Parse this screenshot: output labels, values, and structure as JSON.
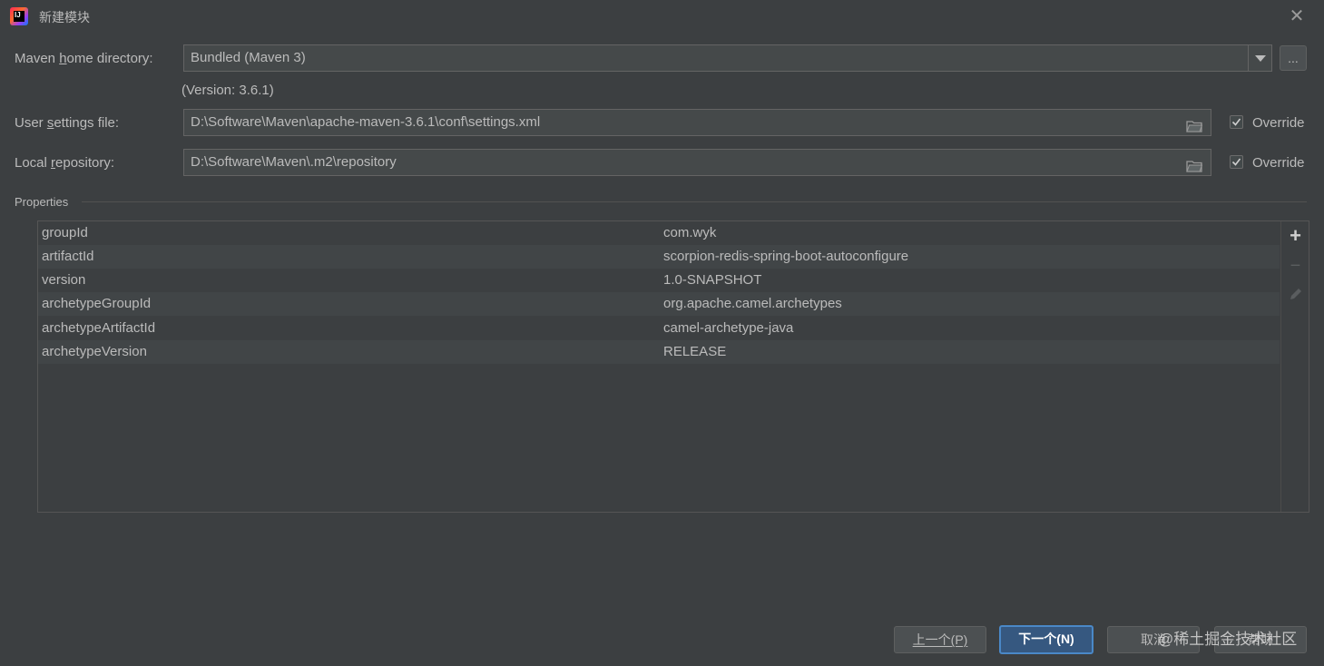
{
  "window": {
    "title": "新建模块"
  },
  "maven_home": {
    "label_pre": "Maven ",
    "label_mn": "h",
    "label_post": "ome directory:",
    "value": "Bundled (Maven 3)",
    "browse_label": "...",
    "version": "(Version: 3.6.1)"
  },
  "user_settings": {
    "label_pre": "User ",
    "label_mn": "s",
    "label_post": "ettings file:",
    "value": "D:\\Software\\Maven\\apache-maven-3.6.1\\conf\\settings.xml",
    "override_label": "Override",
    "override_checked": true
  },
  "local_repo": {
    "label_pre": "Local ",
    "label_mn": "r",
    "label_post": "epository:",
    "value": "D:\\Software\\Maven\\.m2\\repository",
    "override_label": "Override",
    "override_checked": true
  },
  "properties": {
    "title": "Properties",
    "rows": [
      {
        "key": "groupId",
        "value": "com.wyk"
      },
      {
        "key": "artifactId",
        "value": "scorpion-redis-spring-boot-autoconfigure"
      },
      {
        "key": "version",
        "value": "1.0-SNAPSHOT"
      },
      {
        "key": "archetypeGroupId",
        "value": "org.apache.camel.archetypes"
      },
      {
        "key": "archetypeArtifactId",
        "value": "camel-archetype-java"
      },
      {
        "key": "archetypeVersion",
        "value": "RELEASE"
      }
    ],
    "toolbar": {
      "add": "+",
      "remove": "−"
    }
  },
  "buttons": {
    "previous": "上一个(P)",
    "next": "下一个(N)",
    "cancel": "取消",
    "help": "帮助"
  },
  "watermark": "@稀土掘金技术社区",
  "colors": {
    "background": "#3c3f41",
    "field": "#45494a",
    "primary_button": "#365880",
    "primary_border": "#4a88c7"
  }
}
